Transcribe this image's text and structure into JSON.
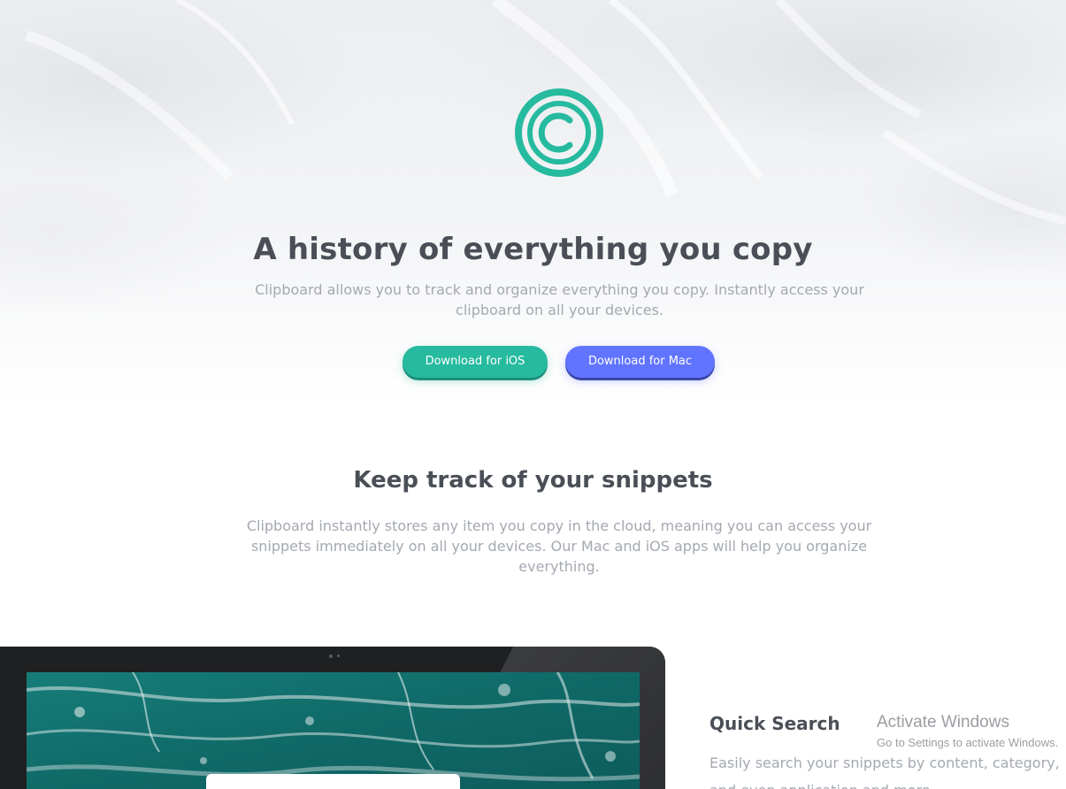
{
  "hero": {
    "logo_icon": "copyright-icon",
    "logo_color": "#26ba9f",
    "title": "A history of everything you copy",
    "text": "Clipboard allows you to track and organize everything you copy. Instantly access your clipboard on all your devices.",
    "buttons": {
      "ios_label": "Download for iOS",
      "mac_label": "Download for Mac"
    }
  },
  "snippets": {
    "title": "Keep track of your snippets",
    "text": "Clipboard instantly stores any item you copy in the cloud, meaning you can access your snippets immediately on all your devices. Our Mac and iOS apps will help you organize everything."
  },
  "features": {
    "quick_search_title": "Quick Search",
    "quick_search_text": "Easily search your snippets by content, category,",
    "quick_search_text_line2": "and even application and more."
  },
  "watermark": {
    "title": "Activate Windows",
    "subtitle": "Go to Settings to activate Windows."
  },
  "colors": {
    "accent_green": "#26ba9f",
    "accent_blue": "#6174ff",
    "heading": "#4a4f57",
    "body": "#a4a9b1"
  }
}
